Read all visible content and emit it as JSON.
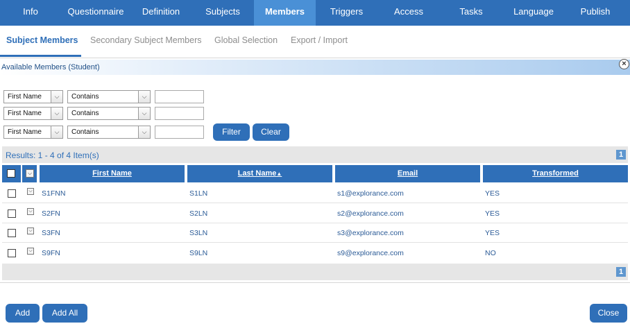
{
  "nav": {
    "tabs": [
      {
        "label": "Info"
      },
      {
        "label": "Questionnaire"
      },
      {
        "label": "Definition"
      },
      {
        "label": "Subjects"
      },
      {
        "label": "Members"
      },
      {
        "label": "Triggers"
      },
      {
        "label": "Access"
      },
      {
        "label": "Tasks"
      },
      {
        "label": "Language"
      },
      {
        "label": "Publish"
      }
    ],
    "active": "Members"
  },
  "subtabs": [
    {
      "label": "Subject Members"
    },
    {
      "label": "Secondary Subject Members"
    },
    {
      "label": "Global Selection"
    },
    {
      "label": "Export / Import"
    }
  ],
  "panel": {
    "title": "Available Members (Student)",
    "close_glyph": "×"
  },
  "filters": [
    {
      "field": "First Name",
      "operator": "Contains",
      "value": ""
    },
    {
      "field": "First Name",
      "operator": "Contains",
      "value": ""
    },
    {
      "field": "First Name",
      "operator": "Contains",
      "value": ""
    }
  ],
  "buttons": {
    "filter": "Filter",
    "clear": "Clear",
    "add": "Add",
    "add_all": "Add All",
    "close": "Close"
  },
  "results": {
    "text": "Results: 1 - 4 of 4 Item(s)",
    "page": "1"
  },
  "table": {
    "columns": [
      "First Name",
      "Last Name",
      "Email",
      "Transformed"
    ],
    "sort_glyph": "▲",
    "rows": [
      {
        "first": "S1FNN",
        "last": "S1LN",
        "email": "s1@explorance.com",
        "transformed": "YES"
      },
      {
        "first": "S2FN",
        "last": "S2LN",
        "email": "s2@explorance.com",
        "transformed": "YES"
      },
      {
        "first": "S3FN",
        "last": "S3LN",
        "email": "s3@explorance.com",
        "transformed": "YES"
      },
      {
        "first": "S9FN",
        "last": "S9LN",
        "email": "s9@explorance.com",
        "transformed": "NO"
      }
    ]
  },
  "colors": {
    "primary": "#2f6fb8",
    "active_tab": "#4a90d6",
    "results_bg": "#e6e6e6"
  }
}
